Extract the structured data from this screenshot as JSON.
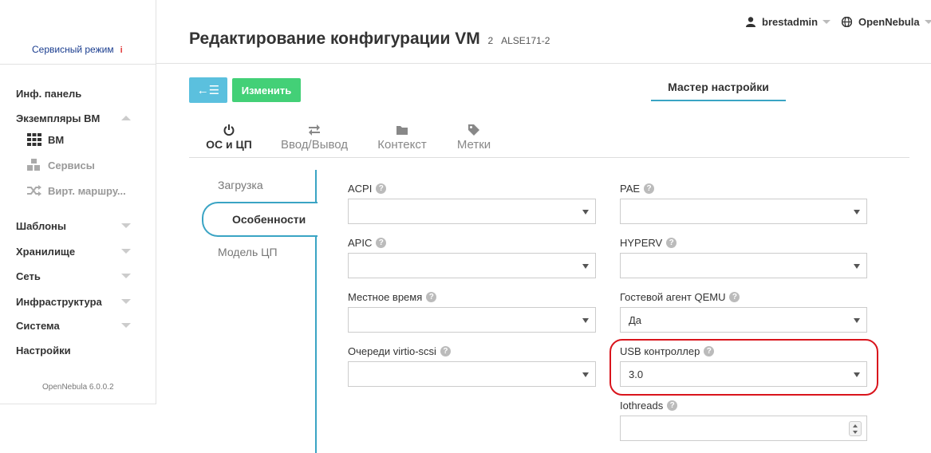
{
  "sidebar": {
    "service_mode": "Сервисный режим",
    "service_mode_info": "i",
    "items": [
      {
        "label": "Инф. панель"
      },
      {
        "label": "Экземпляры ВМ"
      },
      {
        "label": "Шаблоны"
      },
      {
        "label": "Хранилище"
      },
      {
        "label": "Сеть"
      },
      {
        "label": "Инфраструктура"
      },
      {
        "label": "Система"
      },
      {
        "label": "Настройки"
      }
    ],
    "vm_subitems": [
      {
        "label": "ВМ",
        "icon": "grid-icon",
        "active": true
      },
      {
        "label": "Сервисы",
        "icon": "cubes-icon",
        "active": false
      },
      {
        "label": "Вирт. маршру...",
        "icon": "shuffle-icon",
        "active": false
      }
    ],
    "version": "OpenNebula 6.0.0.2"
  },
  "header": {
    "title": "Редактирование конфигурации VM",
    "vm_id": "2",
    "vm_name": "ALSE171-2",
    "user": "brestadmin",
    "zone": "OpenNebula"
  },
  "toolbar": {
    "back_icon": "←☰",
    "apply_label": "Изменить",
    "wizard_tab": "Мастер настройки"
  },
  "tabs": [
    {
      "label": "ОС и ЦП",
      "icon": "power-icon",
      "active": true
    },
    {
      "label": "Ввод/Вывод",
      "icon": "exchange-icon",
      "active": false
    },
    {
      "label": "Контекст",
      "icon": "folder-icon",
      "active": false
    },
    {
      "label": "Метки",
      "icon": "tag-icon",
      "active": false
    }
  ],
  "vtabs": [
    {
      "label": "Загрузка"
    },
    {
      "label": "Особенности"
    },
    {
      "label": "Модель ЦП"
    }
  ],
  "form": {
    "acpi": {
      "label": "ACPI",
      "value": ""
    },
    "pae": {
      "label": "PAE",
      "value": ""
    },
    "apic": {
      "label": "APIC",
      "value": ""
    },
    "hyperv": {
      "label": "HYPERV",
      "value": ""
    },
    "localtime": {
      "label": "Местное время",
      "value": ""
    },
    "qemu_agent": {
      "label": "Гостевой агент QEMU",
      "value": "Да"
    },
    "virtio_scsi": {
      "label": "Очереди virtio-scsi",
      "value": ""
    },
    "usb": {
      "label": "USB контроллер",
      "value": "3.0"
    },
    "iothreads": {
      "label": "Iothreads",
      "value": ""
    }
  },
  "colors": {
    "accent": "#3aa4c4",
    "back_button": "#5bc0de",
    "apply_button": "#43d077",
    "highlight": "#d9141c"
  }
}
